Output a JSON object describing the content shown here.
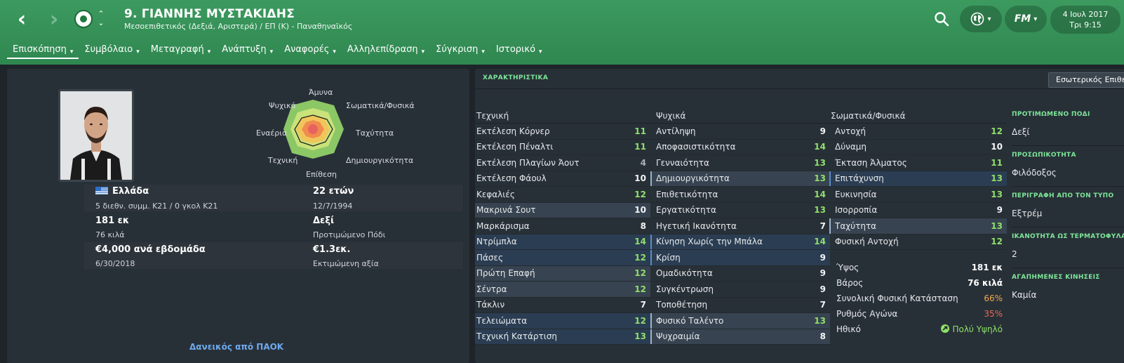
{
  "header": {
    "player_title": "9. ΓΙΑΝΝΗΣ ΜΥΣΤΑΚΙΔΗΣ",
    "player_subtitle": "Μεσοεπιθετικός (Δεξιά, Αριστερά) / ΕΠ (Κ) - Παναθηναϊκός",
    "date": "4 Ιουλ 2017",
    "time": "Τρι 9:15",
    "fm_label": "FM"
  },
  "tabs": [
    {
      "label": "Επισκόπηση"
    },
    {
      "label": "Συμβόλαιο"
    },
    {
      "label": "Μεταγραφή"
    },
    {
      "label": "Ανάπτυξη"
    },
    {
      "label": "Αναφορές"
    },
    {
      "label": "Αλληλεπίδραση"
    },
    {
      "label": "Σύγκριση"
    },
    {
      "label": "Ιστορικό"
    }
  ],
  "radar": {
    "top": "Άμυνα",
    "top_left": "Ψυχικά",
    "top_right": "Σωματικά/Φυσικά",
    "left": "Εναέρια",
    "right": "Ταχύτητα",
    "bottom_left": "Τεχνική",
    "bottom_right": "Δημιουργικότητα",
    "bottom": "Επίθεση"
  },
  "info": {
    "nationality": "Ελλάδα",
    "caps": "5 διεθν. συμμ. Κ21 / 0 γκολ Κ21",
    "age": "22 ετών",
    "dob": "12/7/1994",
    "height": "181 εκ",
    "weight": "76 κιλά",
    "foot": "Δεξί",
    "foot_label": "Προτιμώμενο Πόδι",
    "wage": "€4,000 ανά εβδομάδα",
    "contract_end": "6/30/2018",
    "value": "€1.3εκ.",
    "value_label": "Εκτιμώμενη αξία",
    "loan": "Δανεικός από ΠΑΟΚ"
  },
  "attributes": {
    "section_title": "ΧΑΡΑΚΤΗΡΙΣΤΙΚΑ",
    "dropdown": "Εσωτερικός Επιθετικός",
    "technical_head": "Τεχνική",
    "mental_head": "Ψυχικά",
    "physical_head": "Σωματικά/Φυσικά",
    "technical": [
      {
        "name": "Εκτέλεση Κόρνερ",
        "value": "11"
      },
      {
        "name": "Εκτέλεση Πέναλτι",
        "value": "11"
      },
      {
        "name": "Εκτέλεση Πλαγίων Άουτ",
        "value": "4"
      },
      {
        "name": "Εκτέλεση Φάουλ",
        "value": "10"
      },
      {
        "name": "Κεφαλιές",
        "value": "12"
      },
      {
        "name": "Μακρινά Σουτ",
        "value": "10"
      },
      {
        "name": "Μαρκάρισμα",
        "value": "8"
      },
      {
        "name": "Ντρίμπλα",
        "value": "14"
      },
      {
        "name": "Πάσες",
        "value": "12"
      },
      {
        "name": "Πρώτη Επαφή",
        "value": "12"
      },
      {
        "name": "Σέντρα",
        "value": "12"
      },
      {
        "name": "Τάκλιν",
        "value": "7"
      },
      {
        "name": "Τελειώματα",
        "value": "12"
      },
      {
        "name": "Τεχνική Κατάρτιση",
        "value": "13"
      }
    ],
    "mental": [
      {
        "name": "Αντίληψη",
        "value": "9"
      },
      {
        "name": "Αποφασιστικότητα",
        "value": "14"
      },
      {
        "name": "Γενναιότητα",
        "value": "13"
      },
      {
        "name": "Δημιουργικότητα",
        "value": "13"
      },
      {
        "name": "Επιθετικότητα",
        "value": "14"
      },
      {
        "name": "Εργατικότητα",
        "value": "13"
      },
      {
        "name": "Ηγετική Ικανότητα",
        "value": "7"
      },
      {
        "name": "Κίνηση Χωρίς την Μπάλα",
        "value": "14"
      },
      {
        "name": "Κρίση",
        "value": "9"
      },
      {
        "name": "Ομαδικότητα",
        "value": "9"
      },
      {
        "name": "Συγκέντρωση",
        "value": "9"
      },
      {
        "name": "Τοποθέτηση",
        "value": "7"
      },
      {
        "name": "Φυσικό Ταλέντο",
        "value": "13"
      },
      {
        "name": "Ψυχραιμία",
        "value": "8"
      }
    ],
    "physical": [
      {
        "name": "Αντοχή",
        "value": "12"
      },
      {
        "name": "Δύναμη",
        "value": "10"
      },
      {
        "name": "Έκταση Άλματος",
        "value": "11"
      },
      {
        "name": "Επιτάχυνση",
        "value": "13"
      },
      {
        "name": "Ευκινησία",
        "value": "13"
      },
      {
        "name": "Ισορροπία",
        "value": "9"
      },
      {
        "name": "Ταχύτητα",
        "value": "13"
      },
      {
        "name": "Φυσική Αντοχή",
        "value": "12"
      }
    ],
    "physical_info": [
      {
        "name": "Ύψος",
        "value": "181 εκ"
      },
      {
        "name": "Βάρος",
        "value": "76 κιλά"
      },
      {
        "name": "Συνολική Φυσική Κατάσταση",
        "value": "66%"
      },
      {
        "name": "Ρυθμός Αγώνα",
        "value": "35%"
      },
      {
        "name": "Ηθικό",
        "value": "Πολύ Υψηλό"
      }
    ]
  },
  "side": {
    "preferred_foot_head": "ΠΡΟΤΙΜΩΜΕΝΟ ΠΟΔΙ",
    "preferred_foot": "Δεξί",
    "personality_head": "ΠΡΟΣΩΠΙΚΟΤΗΤΑ",
    "personality": "Φιλόδοξος",
    "media_head": "ΠΕΡΙΓΡΑΦΗ ΑΠΟ ΤΟΝ ΤΥΠΟ",
    "media": "Εξτρέμ",
    "goals_head": "ΙΚΑΝΟΤΗΤΑ ΩΣ ΤΕΡΜΑΤΟΦΥΛΑΚΑ",
    "goals": "2",
    "moves_head": "ΑΓΑΠΗΜΕΝΕΣ ΚΙΝΗΣΕΙΣ",
    "moves": "Καμία"
  },
  "colors": {
    "header_green": "#3c9a5f",
    "panel": "#283037",
    "accent_green": "#7ee69a",
    "value_green": "#8fe06a",
    "loan_blue": "#6ea9ee"
  }
}
